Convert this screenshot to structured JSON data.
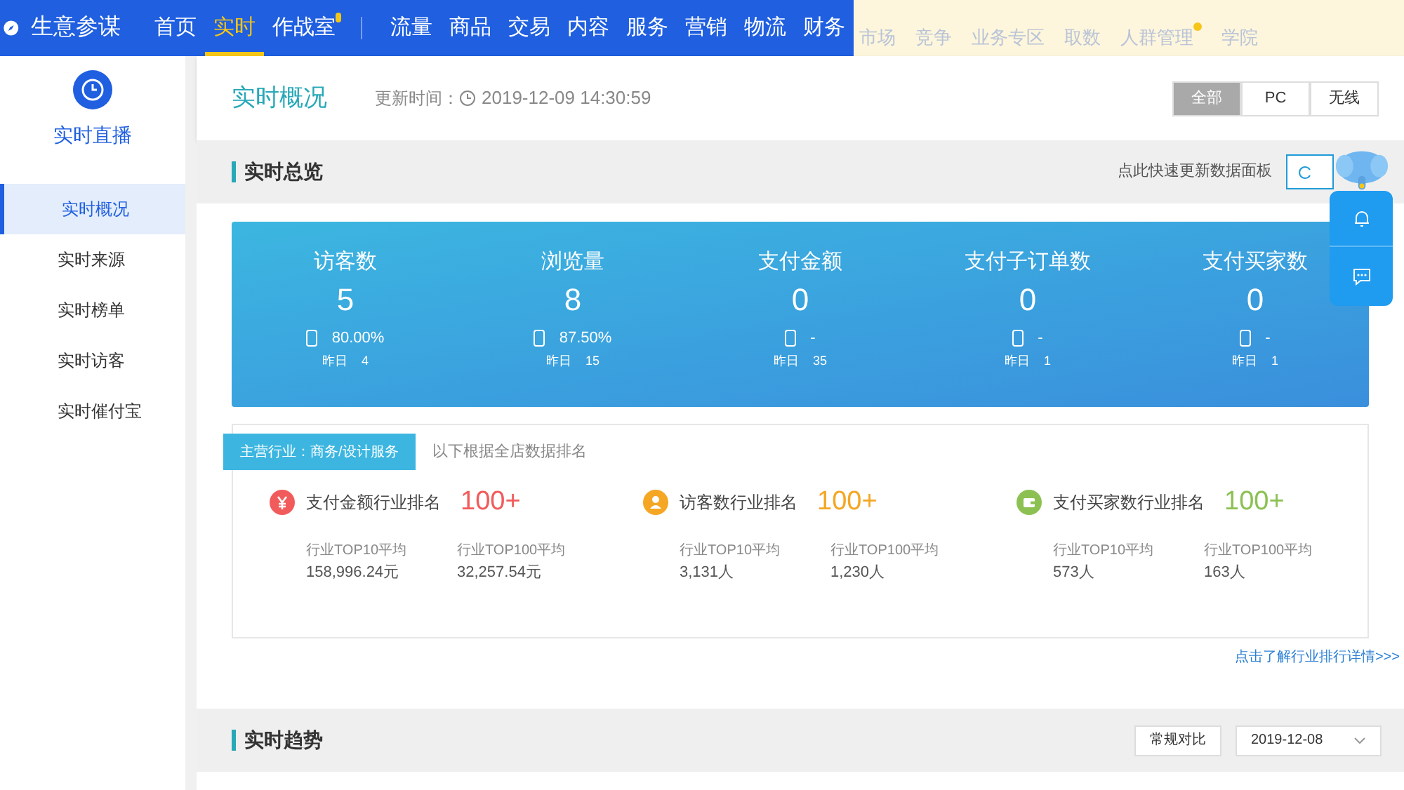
{
  "topbar": {
    "logo": "生意参谋",
    "nav": [
      {
        "label": "首页",
        "selected": false,
        "dot": false
      },
      {
        "label": "实时",
        "selected": true,
        "dot": false
      },
      {
        "label": "作战室",
        "selected": false,
        "dot": true
      }
    ],
    "nav2": [
      {
        "label": "流量"
      },
      {
        "label": "商品"
      },
      {
        "label": "交易"
      },
      {
        "label": "内容"
      },
      {
        "label": "服务"
      },
      {
        "label": "营销"
      },
      {
        "label": "物流"
      },
      {
        "label": "财务"
      }
    ],
    "nav3": [
      {
        "label": "市场",
        "dot": false
      },
      {
        "label": "竞争",
        "dot": false
      },
      {
        "label": "业务专区",
        "dot": false
      },
      {
        "label": "取数",
        "dot": false
      },
      {
        "label": "人群管理",
        "dot": true
      },
      {
        "label": "学院",
        "dot": false
      }
    ]
  },
  "sidebar": {
    "title": "实时直播",
    "items": [
      {
        "label": "实时概况",
        "selected": true
      },
      {
        "label": "实时来源",
        "selected": false
      },
      {
        "label": "实时榜单",
        "selected": false
      },
      {
        "label": "实时访客",
        "selected": false
      },
      {
        "label": "实时催付宝",
        "selected": false
      }
    ]
  },
  "header": {
    "title": "实时概况",
    "update_label": "更新时间：",
    "update_time": "2019-12-09 14:30:59",
    "tabs": [
      {
        "label": "全部",
        "selected": true
      },
      {
        "label": "PC",
        "selected": false
      },
      {
        "label": "无线",
        "selected": false
      }
    ]
  },
  "overview": {
    "title": "实时总览",
    "refresh_hint": "点此快速更新数据面板",
    "metrics": [
      {
        "label": "访客数",
        "value": "5",
        "mobile": "80.00%",
        "yesterday_label": "昨日",
        "yesterday": "4"
      },
      {
        "label": "浏览量",
        "value": "8",
        "mobile": "87.50%",
        "yesterday_label": "昨日",
        "yesterday": "15"
      },
      {
        "label": "支付金额",
        "value": "0",
        "mobile": "-",
        "yesterday_label": "昨日",
        "yesterday": "35"
      },
      {
        "label": "支付子订单数",
        "value": "0",
        "mobile": "-",
        "yesterday_label": "昨日",
        "yesterday": "1"
      },
      {
        "label": "支付买家数",
        "value": "0",
        "mobile": "-",
        "yesterday_label": "昨日",
        "yesterday": "1"
      }
    ],
    "ranking": {
      "tag": "主营行业：商务/设计服务",
      "note": "以下根据全店数据排名",
      "items": [
        {
          "kind": "money",
          "color": "#f25b5b",
          "label": "支付金额行业排名",
          "rank": "100+",
          "top10_label": "行业TOP10平均",
          "top10": "158,996.24元",
          "top100_label": "行业TOP100平均",
          "top100": "32,257.54元"
        },
        {
          "kind": "person",
          "color": "#f5a623",
          "label": "访客数行业排名",
          "rank": "100+",
          "top10_label": "行业TOP10平均",
          "top10": "3,131人",
          "top100_label": "行业TOP100平均",
          "top100": "1,230人"
        },
        {
          "kind": "wallet",
          "color": "#8cc152",
          "label": "支付买家数行业排名",
          "rank": "100+",
          "top10_label": "行业TOP10平均",
          "top10": "573人",
          "top100_label": "行业TOP100平均",
          "top100": "163人"
        }
      ]
    },
    "detail_link": "点击了解行业排行详情>>>"
  },
  "trend": {
    "title": "实时趋势",
    "compare": "常规对比",
    "date": "2019-12-08"
  }
}
